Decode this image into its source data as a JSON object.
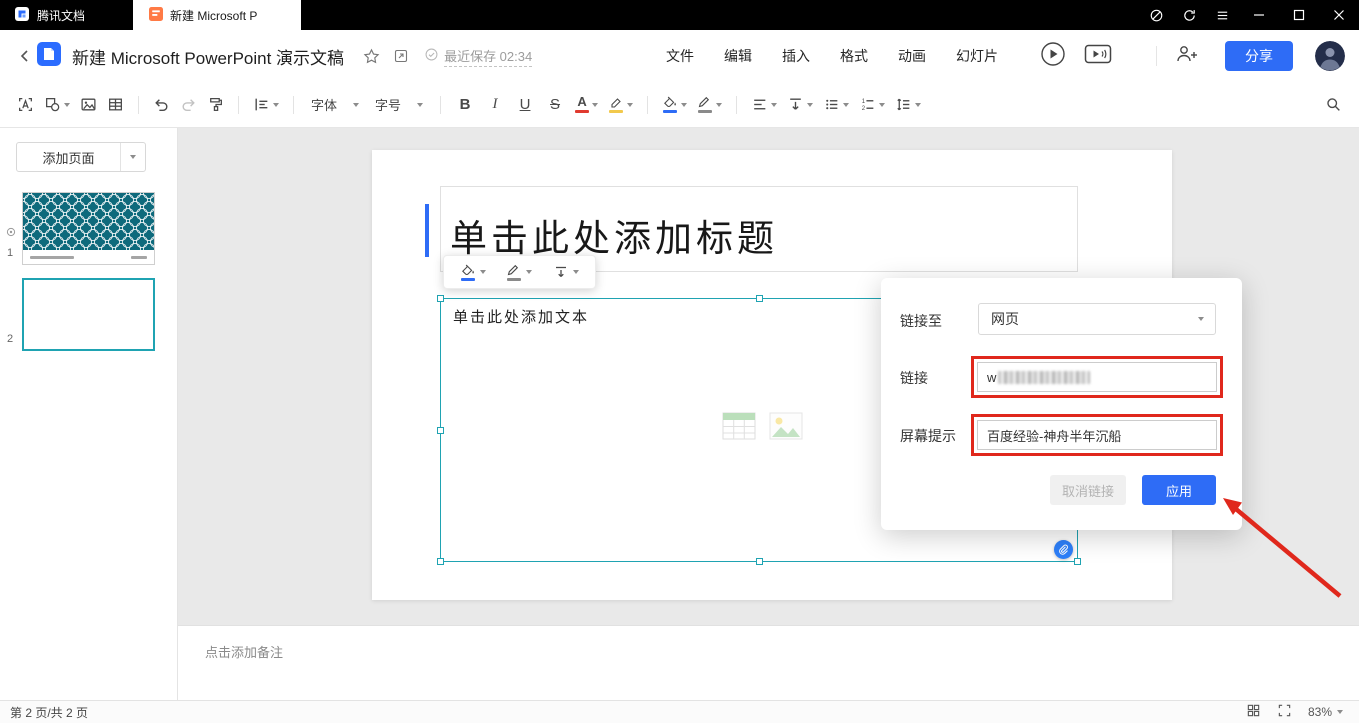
{
  "colors": {
    "accent_blue": "#2e6cf6",
    "selection_teal": "#1fa3b2",
    "annotation_red": "#e0281c",
    "titlebar_bg": "#000000",
    "canvas_bg": "#e9e9e9"
  },
  "titlebar": {
    "app_name": "腾讯文档",
    "tab_title": "新建 Microsoft P"
  },
  "header": {
    "doc_title": "新建 Microsoft PowerPoint 演示文稿",
    "save_status": "最近保存 02:34",
    "menu": [
      "文件",
      "编辑",
      "插入",
      "格式",
      "动画",
      "幻灯片"
    ],
    "share_label": "分享"
  },
  "toolbar": {
    "font_label": "字体",
    "size_label": "字号",
    "bold_label": "B",
    "italic_label": "I",
    "underline_label": "U",
    "strikethrough_label": "S",
    "font_color_letter": "A"
  },
  "sidebar": {
    "add_page_label": "添加页面",
    "slides": [
      {
        "number": "1"
      },
      {
        "number": "2"
      }
    ]
  },
  "slide": {
    "title_placeholder": "单击此处添加标题",
    "body_placeholder": "单击此处添加文本"
  },
  "link_dialog": {
    "link_to_label": "链接至",
    "link_to_value": "网页",
    "link_label": "链接",
    "link_value": "w",
    "screen_tip_label": "屏幕提示",
    "screen_tip_value": "百度经验-神舟半年沉船",
    "cancel_label": "取消链接",
    "apply_label": "应用"
  },
  "notes": {
    "placeholder": "点击添加备注"
  },
  "statusbar": {
    "page_info": "第 2 页/共 2 页",
    "zoom": "83%"
  }
}
